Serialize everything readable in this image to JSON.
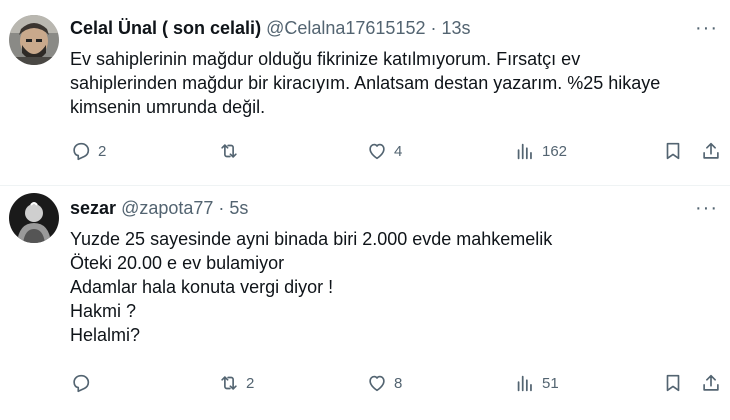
{
  "tweets": [
    {
      "name": "Celal Ünal ( son celali)",
      "handle": "@Celalna17615152",
      "time": "13s",
      "more": "···",
      "lines": [
        "Ev sahiplerinin mağdur olduğu fikrinize katılmıyorum. Fırsatçı ev",
        "sahiplerinden mağdur bir kiracıyım. Anlatsam destan yazarım. %25 hikaye",
        "kimsenin umrunda değil."
      ],
      "replies": "2",
      "retweets": "",
      "likes": "4",
      "views": "162"
    },
    {
      "name": "sezar",
      "handle": "@zapota77",
      "time": "5s",
      "more": "···",
      "lines": [
        "Yuzde 25 sayesinde ayni binada biri 2.000 evde mahkemelik",
        "Öteki 20.00 e ev bulamiyor",
        "Adamlar hala konuta vergi diyor !",
        "Hakmi ?",
        "Helalmi?"
      ],
      "replies": "",
      "retweets": "2",
      "likes": "8",
      "views": "51"
    }
  ],
  "separator": " · ",
  "icons": [
    "reply-icon",
    "retweet-icon",
    "like-icon",
    "views-icon",
    "bookmark-icon",
    "share-icon"
  ]
}
